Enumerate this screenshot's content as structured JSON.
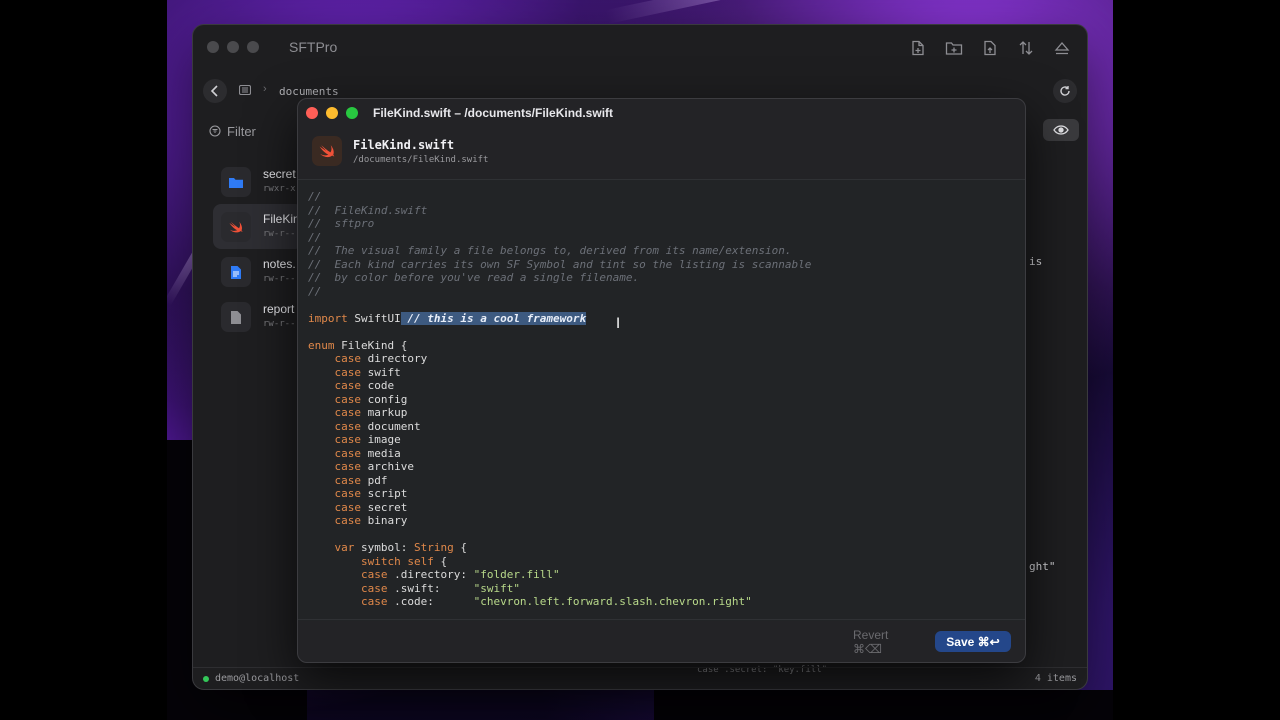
{
  "app": {
    "title": "SFTPro",
    "breadcrumb": "documents",
    "filter_label": "Filter",
    "status_user": "demo@localhost",
    "status_count": "4 items"
  },
  "files": [
    {
      "name": "secret",
      "perm": "rwxr-x",
      "icon": "folder-icon",
      "color": "#2f7bf6"
    },
    {
      "name": "FileKind",
      "perm": "rw-r--",
      "icon": "swift-icon",
      "color": "#f05138"
    },
    {
      "name": "notes.",
      "perm": "rw-r--",
      "icon": "document-icon",
      "color": "#2f7bf6"
    },
    {
      "name": "report",
      "perm": "rw-r--",
      "icon": "document-icon",
      "color": "#8e8e93"
    }
  ],
  "background_text": {
    "fragment_is": "is",
    "fragment_ght": "ght\"",
    "fragment_bottom": "case .secret:    \"key.fill\""
  },
  "editor": {
    "window_title": "FileKind.swift – /documents/FileKind.swift",
    "filename": "FileKind.swift",
    "filepath": "/documents/FileKind.swift",
    "revert_label": "Revert ⌘⌫",
    "save_label": "Save ⌘↩",
    "code_lines": [
      "//",
      "//  FileKind.swift",
      "//  sftpro",
      "//",
      "//  The visual family a file belongs to, derived from its name/extension.",
      "//  Each kind carries its own SF Symbol and tint so the listing is scannable",
      "//  by color before you've read a single filename.",
      "//",
      "",
      "import SwiftUI // this is a cool framework",
      "",
      "enum FileKind {",
      "    case directory",
      "    case swift",
      "    case code",
      "    case config",
      "    case markup",
      "    case document",
      "    case image",
      "    case media",
      "    case archive",
      "    case pdf",
      "    case script",
      "    case secret",
      "    case binary",
      "",
      "    var symbol: String {",
      "        switch self {",
      "        case .directory: \"folder.fill\"",
      "        case .swift:     \"swift\"",
      "        case .code:      \"chevron.left.forward.slash.chevron.right\""
    ]
  },
  "colors": {
    "accent": "#24478a",
    "comment": "#6c7078",
    "keyword": "#e0884a",
    "string": "#b8d98a",
    "selection": "#3d5a80"
  }
}
